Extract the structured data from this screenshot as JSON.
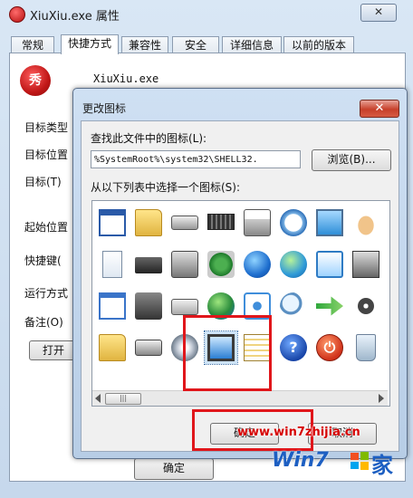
{
  "props_window": {
    "title": "XiuXiu.exe 属性",
    "close": "✕",
    "tabs": [
      "常规",
      "快捷方式",
      "兼容性",
      "安全",
      "详细信息",
      "以前的版本"
    ],
    "active_tab": "快捷方式",
    "file_name": "XiuXiu.exe",
    "app_icon_glyph": "秀",
    "labels": {
      "target_type": "目标类型",
      "target_location": "目标位置",
      "target": "目标(T)",
      "start_in": "起始位置",
      "shortcut_key": "快捷键(",
      "run": "运行方式",
      "comment": "备注(O)"
    },
    "open_button": "打开",
    "ok_button": "确定"
  },
  "change_icon_dialog": {
    "title": "更改图标",
    "close": "✕",
    "look_for_label": "查找此文件中的图标(L):",
    "path_value": "%SystemRoot%\\system32\\SHELL32.",
    "browse_button": "浏览(B)...",
    "select_label": "从以下列表中选择一个图标(S):",
    "scroll_thumb": "|||",
    "icons": [
      "ms-dos-window-icon",
      "folder-icon",
      "drive-icon",
      "memory-chip-icon",
      "printer-icon",
      "clock-icon",
      "monitor-screen-icon",
      "hand-share-icon",
      "document-icon",
      "server-drive-icon",
      "network-drive-icon",
      "chip-board-icon",
      "globe-icon",
      "network-globe-icon",
      "control-panel-icon",
      "floppy-monitor-icon",
      "window-icon",
      "save-drive-icon",
      "removable-drive-icon",
      "internet-globe-icon",
      "network-tree-icon",
      "search-magnifier-icon",
      "green-arrow-icon",
      "cd-small-icon",
      "folder-icon",
      "hard-drive-icon",
      "cd-drive-icon",
      "desktop-computer-icon",
      "list-window-icon",
      "help-icon",
      "power-icon",
      "recycle-bin-icon"
    ],
    "ok_button": "确定",
    "cancel_button": "取消"
  },
  "watermark": {
    "url": "www.win7zhijia.cn",
    "brand": "Win7",
    "brand_suffix": "家"
  }
}
